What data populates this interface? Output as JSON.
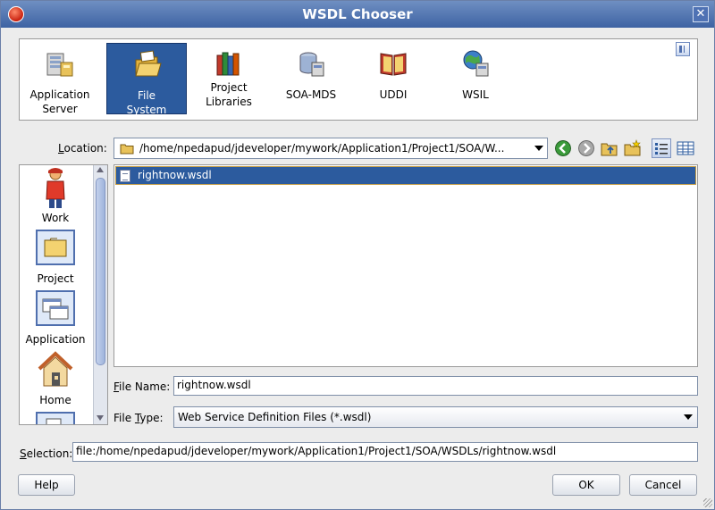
{
  "window": {
    "title": "WSDL Chooser",
    "close_glyph": "✕"
  },
  "connections": [
    {
      "label_line1": "Application",
      "label_line2": "Server",
      "icon": "application-server-icon"
    },
    {
      "label_line1": "File",
      "label_line2": "System",
      "icon": "file-system-icon",
      "selected": true
    },
    {
      "label_line1": "Project",
      "label_line2": "Libraries",
      "icon": "project-libraries-icon"
    },
    {
      "label_line1": "SOA-MDS",
      "label_line2": "",
      "icon": "soa-mds-icon"
    },
    {
      "label_line1": "UDDI",
      "label_line2": "",
      "icon": "uddi-icon"
    },
    {
      "label_line1": "WSIL",
      "label_line2": "",
      "icon": "wsil-icon"
    }
  ],
  "location": {
    "label_mnemonic": "L",
    "label_rest": "ocation:",
    "path": "/home/npedapud/jdeveloper/mywork/Application1/Project1/SOA/W..."
  },
  "places": [
    {
      "label": "Work",
      "icon": "work-icon"
    },
    {
      "label": "Project",
      "icon": "project-icon"
    },
    {
      "label": "Application",
      "icon": "application-icon"
    },
    {
      "label": "Home",
      "icon": "home-icon"
    }
  ],
  "files": [
    {
      "name": "rightnow.wsdl",
      "icon": "wsdl-file-icon",
      "selected": true
    }
  ],
  "file_name": {
    "label_mnemonic": "F",
    "label_rest": "ile Name:",
    "value": "rightnow.wsdl"
  },
  "file_type": {
    "label_pre": "File ",
    "label_mnemonic": "T",
    "label_rest": "ype:",
    "value": "Web Service Definition Files (*.wsdl)"
  },
  "selection": {
    "label_mnemonic": "S",
    "label_rest": "election:",
    "value": "file:/home/npedapud/jdeveloper/mywork/Application1/Project1/SOA/WSDLs/rightnow.wsdl"
  },
  "buttons": {
    "help": "Help",
    "ok": "OK",
    "cancel": "Cancel"
  },
  "colors": {
    "selection": "#2c5b9e",
    "title_bar": "#3e63a3"
  }
}
